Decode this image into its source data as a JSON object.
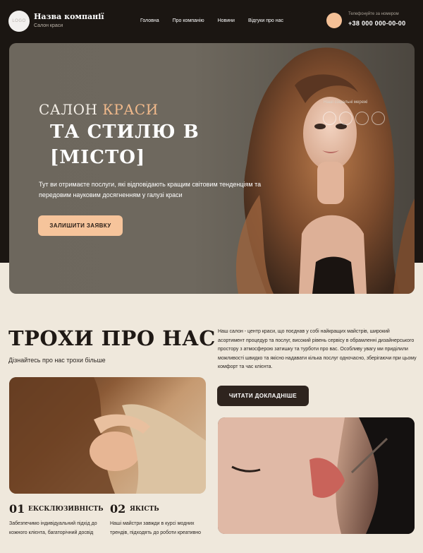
{
  "header": {
    "logo_text": "LOGO",
    "company_name": "Назва компанії",
    "company_sub": "Салон краси",
    "nav": [
      "Головна",
      "Про компанію",
      "Новини",
      "Відгуки про нас"
    ],
    "phone_label": "Телефонуйте за номером",
    "phone_number": "+38 000 000-00-00"
  },
  "hero": {
    "title_prefix": "САЛОН",
    "title_accent": "КРАСИ",
    "title_big_line1": "ТА СТИЛЮ В",
    "title_big_line2": "[МІСТО]",
    "description": "Тут ви отримаєте послуги, які відповідають кращим світовим тенденціям та передовим науковим досягненням у галузі краси",
    "cta_label": "ЗАЛИШИТИ ЗАЯВКУ",
    "social_label": "Наші соціальні мережі"
  },
  "about": {
    "title": "ТРОХИ ПРО НАС",
    "subtitle": "Дізнайтесь про нас трохи більше",
    "text": "Наш салон - центр краси, що поєднав у собі найкращих майстрів, широкий асортимент процедур та послуг, високий рівень сервісу в обрамленні дизайнерського простору з атмосферою затишку та турботи про вас. Особливу увагу ми приділили можливості швидко та якісно надавати кілька послуг одночасно, зберігаючи при цьому комфорт та час клієнта.",
    "read_more_label": "ЧИТАТИ ДОКЛАДНІШЕ"
  },
  "features": [
    {
      "number": "01",
      "name": "ЕКСКЛЮЗИВНІСТЬ",
      "text": "Забезпечимо індивідуальний підхід до кожного клієнта, багаторічний досвід"
    },
    {
      "number": "02",
      "name": "ЯКІСТЬ",
      "text": "Наші майстри завжди в курсі модних трендів, підходять до роботи креативно"
    }
  ],
  "colors": {
    "dark": "#1b1612",
    "accent": "#f6c49b",
    "cream": "#efe8dc"
  }
}
